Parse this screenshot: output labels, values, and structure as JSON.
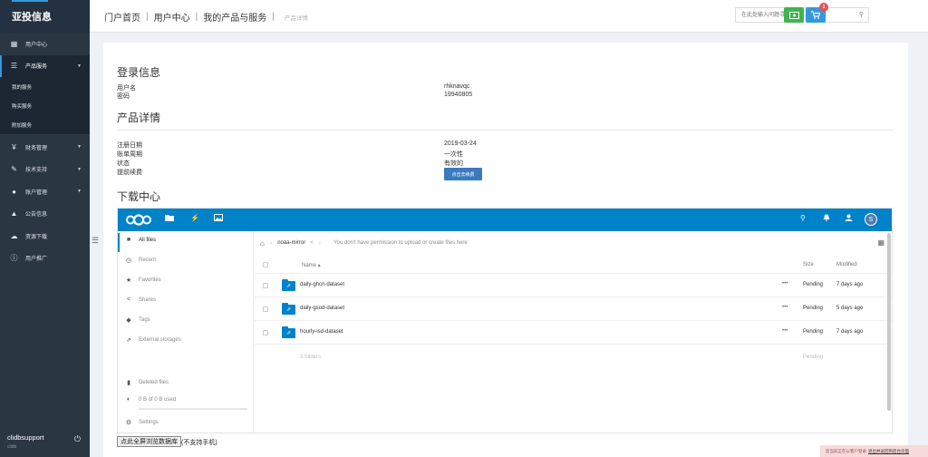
{
  "sidebar": {
    "brand": "亚投信息",
    "items": [
      {
        "label": "用户中心",
        "icon": "grid-icon"
      },
      {
        "label": "产品服务",
        "icon": "list-icon",
        "active": true
      },
      {
        "label": "财务管理",
        "icon": "yen-icon"
      },
      {
        "label": "技术支持",
        "icon": "wrench-icon"
      },
      {
        "label": "账户管理",
        "icon": "user-icon"
      },
      {
        "label": "公告信息",
        "icon": "bell-icon"
      },
      {
        "label": "资源下载",
        "icon": "cloud-download-icon"
      },
      {
        "label": "用户推广",
        "icon": "info-icon"
      }
    ],
    "submenu": [
      "我的服务",
      "购买服务",
      "附加服务"
    ],
    "username": "clidbsupport",
    "user_sub": "clidb"
  },
  "header": {
    "breadcrumb": [
      "门户首页",
      "用户中心",
      "我的产品与服务"
    ],
    "breadcrumb_current": "产品详情",
    "search_placeholder": "在此处输入问题寻找答案...",
    "cart_badge": "1"
  },
  "login_info": {
    "title": "登录信息",
    "username_label": "用户名",
    "username_value": "rhknavqc",
    "password_label": "密码",
    "password_value": "19940805"
  },
  "product_details": {
    "title": "产品详情",
    "register_label": "注册日期",
    "register_value": "2019-03-24",
    "billing_label": "账单周期",
    "billing_value": "一次性",
    "status_label": "状态",
    "status_value": "有效的",
    "renew_label": "提前续费",
    "renew_button": "点击去续费"
  },
  "download": {
    "title": "下载中心"
  },
  "nextcloud": {
    "avatar_letter": "S",
    "sidebar": [
      {
        "label": "All files",
        "icon": "folder-icon"
      },
      {
        "label": "Recent",
        "icon": "clock-icon"
      },
      {
        "label": "Favorites",
        "icon": "star-icon"
      },
      {
        "label": "Shares",
        "icon": "share-icon"
      },
      {
        "label": "Tags",
        "icon": "tag-icon"
      },
      {
        "label": "External storages",
        "icon": "external-icon"
      },
      {
        "label": "Deleted files",
        "icon": "trash-icon"
      },
      {
        "label": "0 B of 0 B used",
        "icon": "pie-icon"
      },
      {
        "label": "Settings",
        "icon": "gear-icon"
      }
    ],
    "crumb_folder": "noaa-mirror",
    "crumb_message": "You don't have permission to upload or create files here",
    "columns": {
      "name": "Name",
      "size": "Size",
      "modified": "Modified"
    },
    "rows": [
      {
        "name": "daily-ghcn-dataset",
        "size": "Pending",
        "modified": "7 days ago"
      },
      {
        "name": "daily-gsod-dataset",
        "size": "Pending",
        "modified": "5 days ago"
      },
      {
        "name": "hourly-isd-dataset",
        "size": "Pending",
        "modified": "7 days ago"
      }
    ],
    "summary_count": "3 folders",
    "summary_size": "Pending"
  },
  "fullscreen_button": "点此全屏浏览数据库",
  "fullscreen_note": "(不支持手机)",
  "cookie_text": "您当前正在以客户登录",
  "cookie_link": "退出并返回到后台页面"
}
